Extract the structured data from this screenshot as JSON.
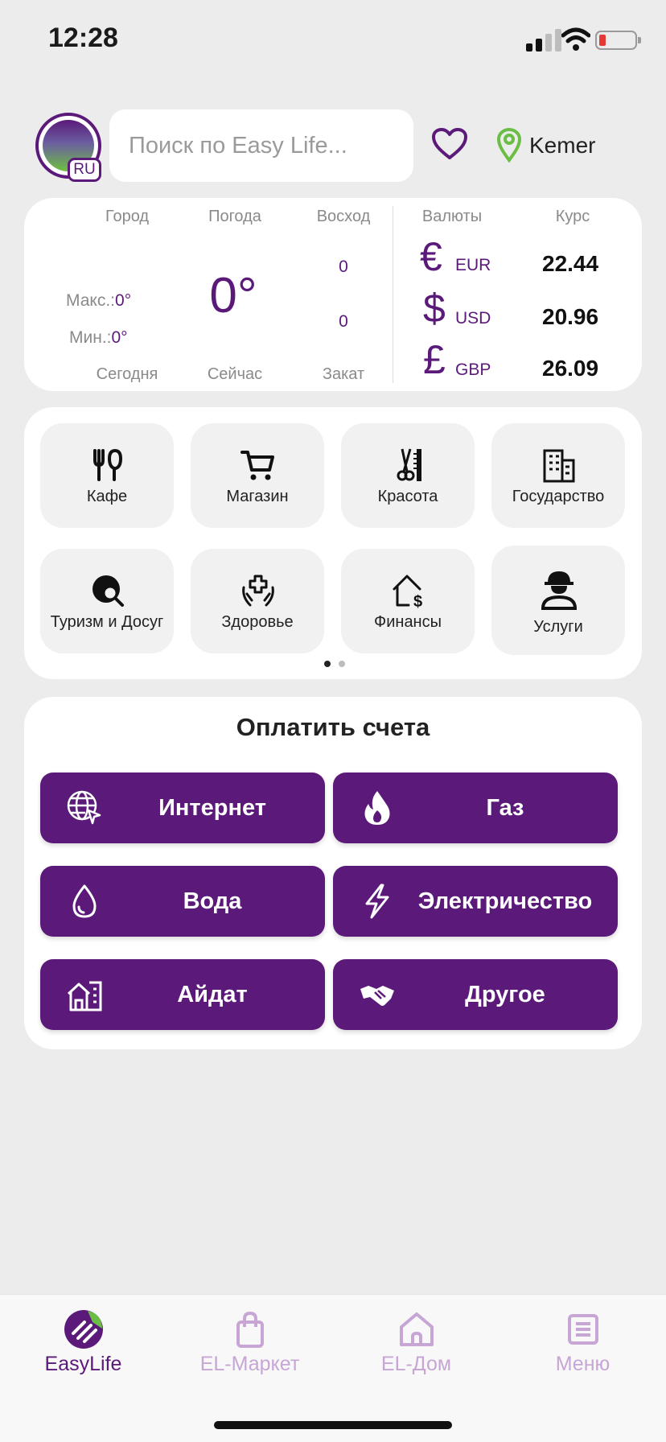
{
  "status_bar": {
    "time": "12:28"
  },
  "header": {
    "language": "RU",
    "search_placeholder": "Поиск по Easy Life...",
    "city": "Kemer"
  },
  "weather": {
    "col_city": "Город",
    "col_weather": "Погода",
    "col_sunrise": "Восход",
    "max_label": "Макс.:",
    "max_value": "0°",
    "min_label": "Мин.:",
    "min_value": "0°",
    "now_temp": "0°",
    "sunrise_value": "0",
    "sunset_value": "0",
    "today_label": "Сегодня",
    "now_label": "Сейчас",
    "sunset_label": "Закат"
  },
  "currency": {
    "col_currency": "Валюты",
    "col_rate": "Курс",
    "items": [
      {
        "symbol": "€",
        "code": "EUR",
        "rate": "22.44"
      },
      {
        "symbol": "$",
        "code": "USD",
        "rate": "20.96"
      },
      {
        "symbol": "£",
        "code": "GBP",
        "rate": "26.09"
      }
    ]
  },
  "categories": {
    "items": [
      {
        "label": "Кафе",
        "icon": "fork-spoon-icon"
      },
      {
        "label": "Магазин",
        "icon": "cart-icon"
      },
      {
        "label": "Красота",
        "icon": "scissors-comb-icon"
      },
      {
        "label": "Государство",
        "icon": "building-icon"
      },
      {
        "label": "Туризм и Досуг",
        "icon": "globe-search-icon"
      },
      {
        "label": "Здоровье",
        "icon": "health-hands-icon"
      },
      {
        "label": "Финансы",
        "icon": "house-dollar-icon"
      },
      {
        "label": "Услуги",
        "icon": "worker-icon"
      }
    ],
    "page_count": 2,
    "active_page": 1
  },
  "bills": {
    "title": "Оплатить счета",
    "buttons": [
      {
        "label": "Интернет",
        "icon": "globe-cursor-icon"
      },
      {
        "label": "Газ",
        "icon": "flame-icon"
      },
      {
        "label": "Вода",
        "icon": "drop-icon"
      },
      {
        "label": "Электричество",
        "icon": "lightning-icon"
      },
      {
        "label": "Айдат",
        "icon": "buildings-icon"
      },
      {
        "label": "Другое",
        "icon": "handshake-icon"
      }
    ]
  },
  "tabbar": {
    "tabs": [
      {
        "label": "EasyLife",
        "icon": "easylife-logo-icon",
        "active": true
      },
      {
        "label": "EL-Маркет",
        "icon": "bag-icon",
        "active": false
      },
      {
        "label": "EL-Дом",
        "icon": "home-icon",
        "active": false
      },
      {
        "label": "Меню",
        "icon": "menu-list-icon",
        "active": false
      }
    ]
  },
  "colors": {
    "brand": "#5B1A7A",
    "accent_green": "#6BBE45",
    "tab_inactive": "#C7A6D6"
  }
}
